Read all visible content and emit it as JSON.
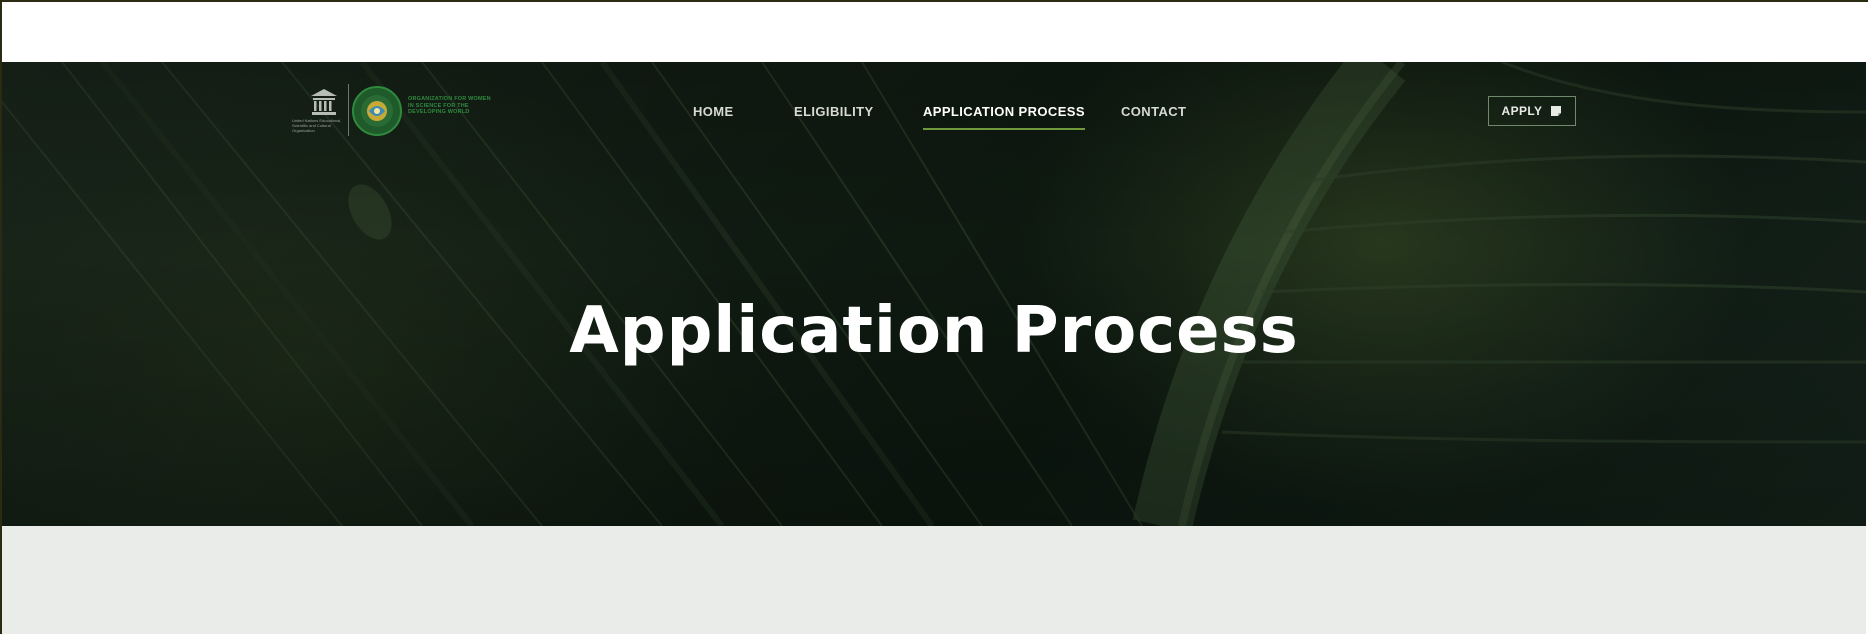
{
  "header": {
    "logos": {
      "unesco_caption": "United Nations Educational, Scientific and Cultural Organization",
      "owsd_caption": "ORGANIZATION FOR WOMEN IN SCIENCE FOR THE DEVELOPING WORLD"
    },
    "nav": [
      {
        "label": "HOME",
        "active": false
      },
      {
        "label": "ELIGIBILITY",
        "active": false
      },
      {
        "label": "APPLICATION PROCESS",
        "active": true
      },
      {
        "label": "CONTACT",
        "active": false
      }
    ],
    "apply_button": {
      "label": "APPLY",
      "icon": "document-icon"
    }
  },
  "hero": {
    "title": "Application Process"
  },
  "colors": {
    "hero_background": "#101b12",
    "accent_underline": "#6f9a3c",
    "content_background": "#e9ece8"
  }
}
